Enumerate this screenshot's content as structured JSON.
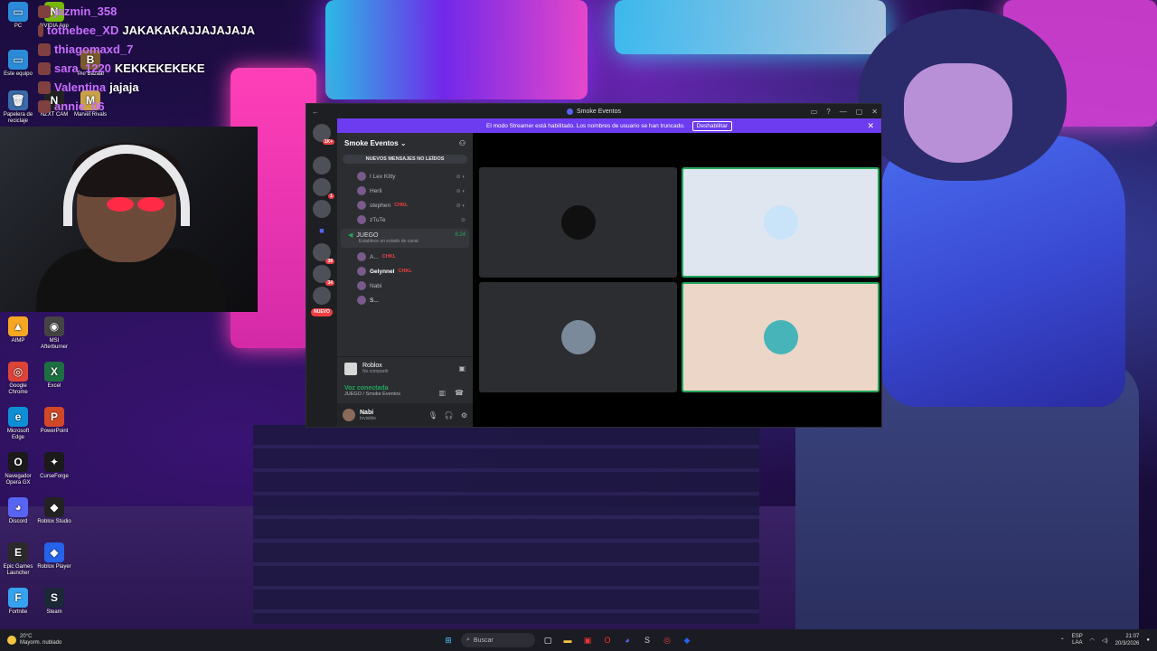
{
  "desktop": {
    "icons": [
      {
        "label": "PC",
        "glyph": "▭",
        "color": "#2b8bd8"
      },
      {
        "label": "Este equipo",
        "glyph": "▭",
        "color": "#2b8bd8"
      },
      {
        "label": "Papelera de reciclaje",
        "glyph": "🗑",
        "color": "#3a6aa8"
      },
      {
        "label": "NVIDIA App",
        "glyph": "N",
        "color": "#76b900"
      },
      {
        "label": "NZXT CAM",
        "glyph": "N",
        "color": "#222"
      },
      {
        "label": "The Bazaar",
        "glyph": "B",
        "color": "#7a5a2a"
      },
      {
        "label": "Marvel Rivals",
        "glyph": "M",
        "color": "#c9a14a"
      },
      {
        "label": "AIMP",
        "glyph": "▲",
        "color": "#f5a623"
      },
      {
        "label": "MSI Afterburner",
        "glyph": "◉",
        "color": "#444"
      },
      {
        "label": "Google Chrome",
        "glyph": "◎",
        "color": "#db4437"
      },
      {
        "label": "Excel",
        "glyph": "X",
        "color": "#1d6f42"
      },
      {
        "label": "Microsoft Edge",
        "glyph": "e",
        "color": "#0c8fd4"
      },
      {
        "label": "PowerPoint",
        "glyph": "P",
        "color": "#d24726"
      },
      {
        "label": "Navegador Opera GX",
        "glyph": "O",
        "color": "#1a1a1a"
      },
      {
        "label": "CurseForge",
        "glyph": "✦",
        "color": "#1a1a1a"
      },
      {
        "label": "Discord",
        "glyph": "◕",
        "color": "#5865f2"
      },
      {
        "label": "Roblox Studio",
        "glyph": "◆",
        "color": "#222"
      },
      {
        "label": "Epic Games Launcher",
        "glyph": "E",
        "color": "#2a2a2a"
      },
      {
        "label": "Roblox Player",
        "glyph": "◆",
        "color": "#2563eb"
      },
      {
        "label": "Fortnite",
        "glyph": "F",
        "color": "#36a3f0"
      },
      {
        "label": "Steam",
        "glyph": "S",
        "color": "#1b2838"
      }
    ]
  },
  "chat": [
    {
      "name": "jazmin_358",
      "msg": ""
    },
    {
      "name": "tothebee_XD",
      "msg": "JAKAKAKAJJAJAJAJA"
    },
    {
      "name": "thiagomaxd_7",
      "msg": ""
    },
    {
      "name": "sara_1220",
      "msg": "KEKKEKEKEKE"
    },
    {
      "name": "Valentina",
      "msg": "jajaja"
    },
    {
      "name": "annie_06",
      "msg": ""
    }
  ],
  "discord": {
    "window_title": "Smoke Eventos",
    "banner_text": "El modo Streamer está habilitado. Los nombres de usuario se han truncado.",
    "banner_button": "Deshabilitar",
    "server_name": "Smoke Eventos",
    "new_messages": "NUEVOS MENSAJES NO LEÍDOS",
    "guild_badges": [
      "1K+",
      "",
      "1",
      "",
      "",
      "38",
      "34",
      ""
    ],
    "new_label": "NUEVO",
    "members_top": [
      {
        "name": "I Lex Kitty",
        "tag": ""
      },
      {
        "name": "Herli",
        "tag": ""
      },
      {
        "name": "stephen",
        "tag": "CHKL"
      },
      {
        "name": "zTuTe",
        "tag": ""
      }
    ],
    "voice_channel": {
      "name": "JUEGO",
      "timer": "6:24",
      "status": "Establece un estado de canal"
    },
    "voice_members": [
      {
        "name": "A...",
        "tag": "CHKL"
      },
      {
        "name": "Gelynnel",
        "tag": "CHKL"
      },
      {
        "name": "Nabi",
        "tag": ""
      },
      {
        "name": "S...",
        "tag": ""
      }
    ],
    "activity": {
      "game": "Roblox",
      "sub": "No compartir"
    },
    "voice_connected": {
      "title": "Voz conectada",
      "sub": "JUEGO / Smoke Eventos"
    },
    "user": {
      "name": "Nabi",
      "status": "Invisible"
    }
  },
  "taskbar": {
    "weather_temp": "20°C",
    "weather_desc": "Mayorm. nublado",
    "search_placeholder": "Buscar",
    "lang": "ESP",
    "lang_sub": "LAA",
    "time": "21:07",
    "date": "20/3/2026"
  }
}
